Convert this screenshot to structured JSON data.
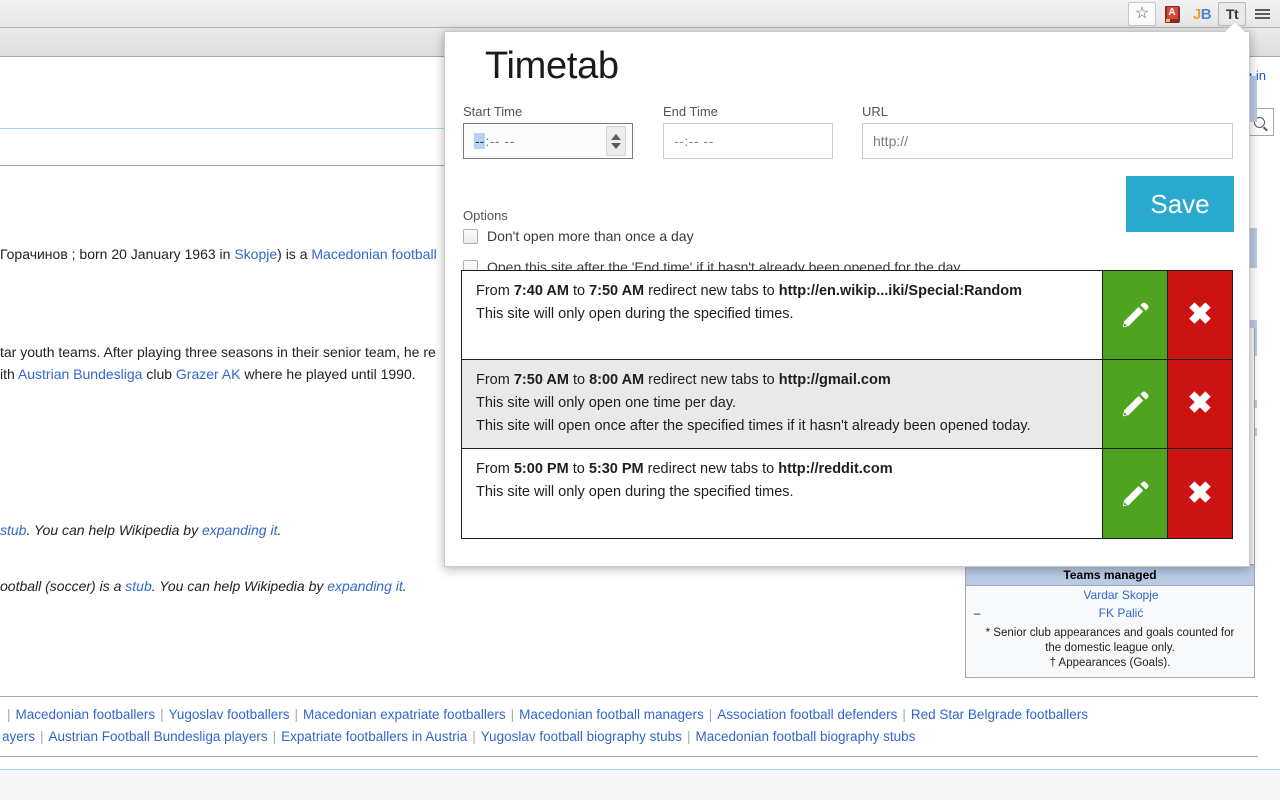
{
  "browser": {
    "toolbar_icons": [
      {
        "name": "bookmark-star-icon",
        "glyph": "☆"
      },
      {
        "name": "dictionary-extension-icon",
        "glyph": "A"
      },
      {
        "name": "jb-extension-icon",
        "glyph_left": "J",
        "glyph_right": "B"
      },
      {
        "name": "timetab-extension-icon",
        "glyph": "Tt"
      },
      {
        "name": "chrome-menu-icon",
        "glyph": "☰"
      }
    ]
  },
  "popup": {
    "title": "Timetab",
    "start_time": {
      "label": "Start Time",
      "selected_segment": "--",
      "rest": ":-- --"
    },
    "end_time": {
      "label": "End Time",
      "value": "--:-- --"
    },
    "url": {
      "label": "URL",
      "placeholder": "http://",
      "value": ""
    },
    "options": {
      "label": "Options",
      "items": [
        {
          "label": "Don't open more than once a day",
          "checked": false
        },
        {
          "label": "Open this site after the 'End time' if it hasn't already been opened for the day",
          "checked": false
        }
      ]
    },
    "save_label": "Save",
    "colors": {
      "save_button": "#29a9ce",
      "edit_button": "#4ea320",
      "delete_button": "#cc1313",
      "selected_segment": "#b5d3f5"
    },
    "rules": [
      {
        "prefix": "From ",
        "start": "7:40 AM",
        "mid": " to ",
        "end": "7:50 AM",
        "suffix": " redirect new tabs to ",
        "url": "http://en.wikip...iki/Special:Random",
        "line2": "This site will only open during the specified times.",
        "line3": "",
        "edit_label": "edit",
        "delete_label": "✖",
        "alt_background": false
      },
      {
        "prefix": "From ",
        "start": "7:50 AM",
        "mid": " to ",
        "end": "8:00 AM",
        "suffix": " redirect new tabs to ",
        "url": "http://gmail.com",
        "line2": "This site will only open one time per day.",
        "line3": "This site will open once after the specified times if it hasn't already been opened today.",
        "edit_label": "edit",
        "delete_label": "✖",
        "alt_background": true
      },
      {
        "prefix": "From ",
        "start": "5:00 PM",
        "mid": " to ",
        "end": "5:30 PM",
        "suffix": " redirect new tabs to ",
        "url": "http://reddit.com",
        "line2": "This site will only open during the specified times.",
        "line3": "",
        "edit_label": "edit",
        "delete_label": "✖",
        "alt_background": false
      }
    ]
  },
  "page": {
    "login_label": "g in",
    "lead_paragraph": {
      "pre": "Горачинов ; born 20 January 1963 in ",
      "link1": "Skopje",
      "mid": ") is a ",
      "link2": "Macedonian football"
    },
    "body_paragraph": {
      "line1": "tar youth teams. After playing three seasons in their senior team, he re",
      "line2_pre": "ith ",
      "line2_link1": "Austrian Bundesliga",
      "line2_mid": " club ",
      "line2_link2": "Grazer AK",
      "line2_post": " where he played until 1990."
    },
    "stub1": {
      "pre": "stub",
      "mid": ". You can help Wikipedia by ",
      "link": "expanding it",
      "post": "."
    },
    "stub2": {
      "pre": "ootball (soccer) is a ",
      "link1": "stub",
      "mid": ". You can help Wikipedia by ",
      "link2": "expanding it",
      "post": "."
    },
    "infobox": {
      "header": "Teams managed",
      "rows": [
        {
          "dash": "",
          "team": "Vardar Skopje"
        },
        {
          "dash": "–",
          "team": "FK Palić"
        }
      ],
      "note_line1": "* Senior club appearances and goals counted for",
      "note_line2": "the domestic league only.",
      "note_line3": "† Appearances (Goals)."
    },
    "categories": {
      "row1": [
        "Macedonian footballers",
        "Yugoslav footballers",
        "Macedonian expatriate footballers",
        "Macedonian football managers",
        "Association football defenders",
        "Red Star Belgrade footballers"
      ],
      "row2": [
        "ayers",
        "Austrian Football Bundesliga players",
        "Expatriate footballers in Austria",
        "Yugoslav football biography stubs",
        "Macedonian football biography stubs"
      ]
    }
  }
}
